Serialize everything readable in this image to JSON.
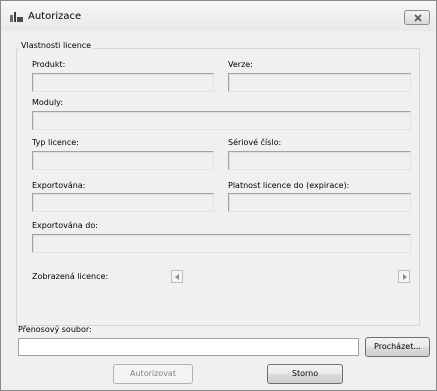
{
  "window": {
    "title": "Autorizace",
    "icons": {
      "app": "key-icon",
      "close": "close-icon"
    }
  },
  "license_group": {
    "legend": "Vlastnosti licence",
    "product": {
      "label": "Produkt:",
      "value": ""
    },
    "version": {
      "label": "Verze:",
      "value": ""
    },
    "modules": {
      "label": "Moduly:",
      "value": ""
    },
    "license_type": {
      "label": "Typ licence:",
      "value": ""
    },
    "serial_number": {
      "label": "Sériové číslo:",
      "value": ""
    },
    "exported": {
      "label": "Exportována:",
      "value": ""
    },
    "valid_until": {
      "label": "Platnost licence do (expirace):",
      "value": ""
    },
    "exported_to": {
      "label": "Exportována do:",
      "value": ""
    },
    "displayed_license": {
      "label": "Zobrazená licence:"
    }
  },
  "transfer": {
    "label": "Přenosový soubor:",
    "value": "",
    "browse_label": "Procházet..."
  },
  "buttons": {
    "authorize_label": "Autorizovat",
    "cancel_label": "Storno"
  }
}
